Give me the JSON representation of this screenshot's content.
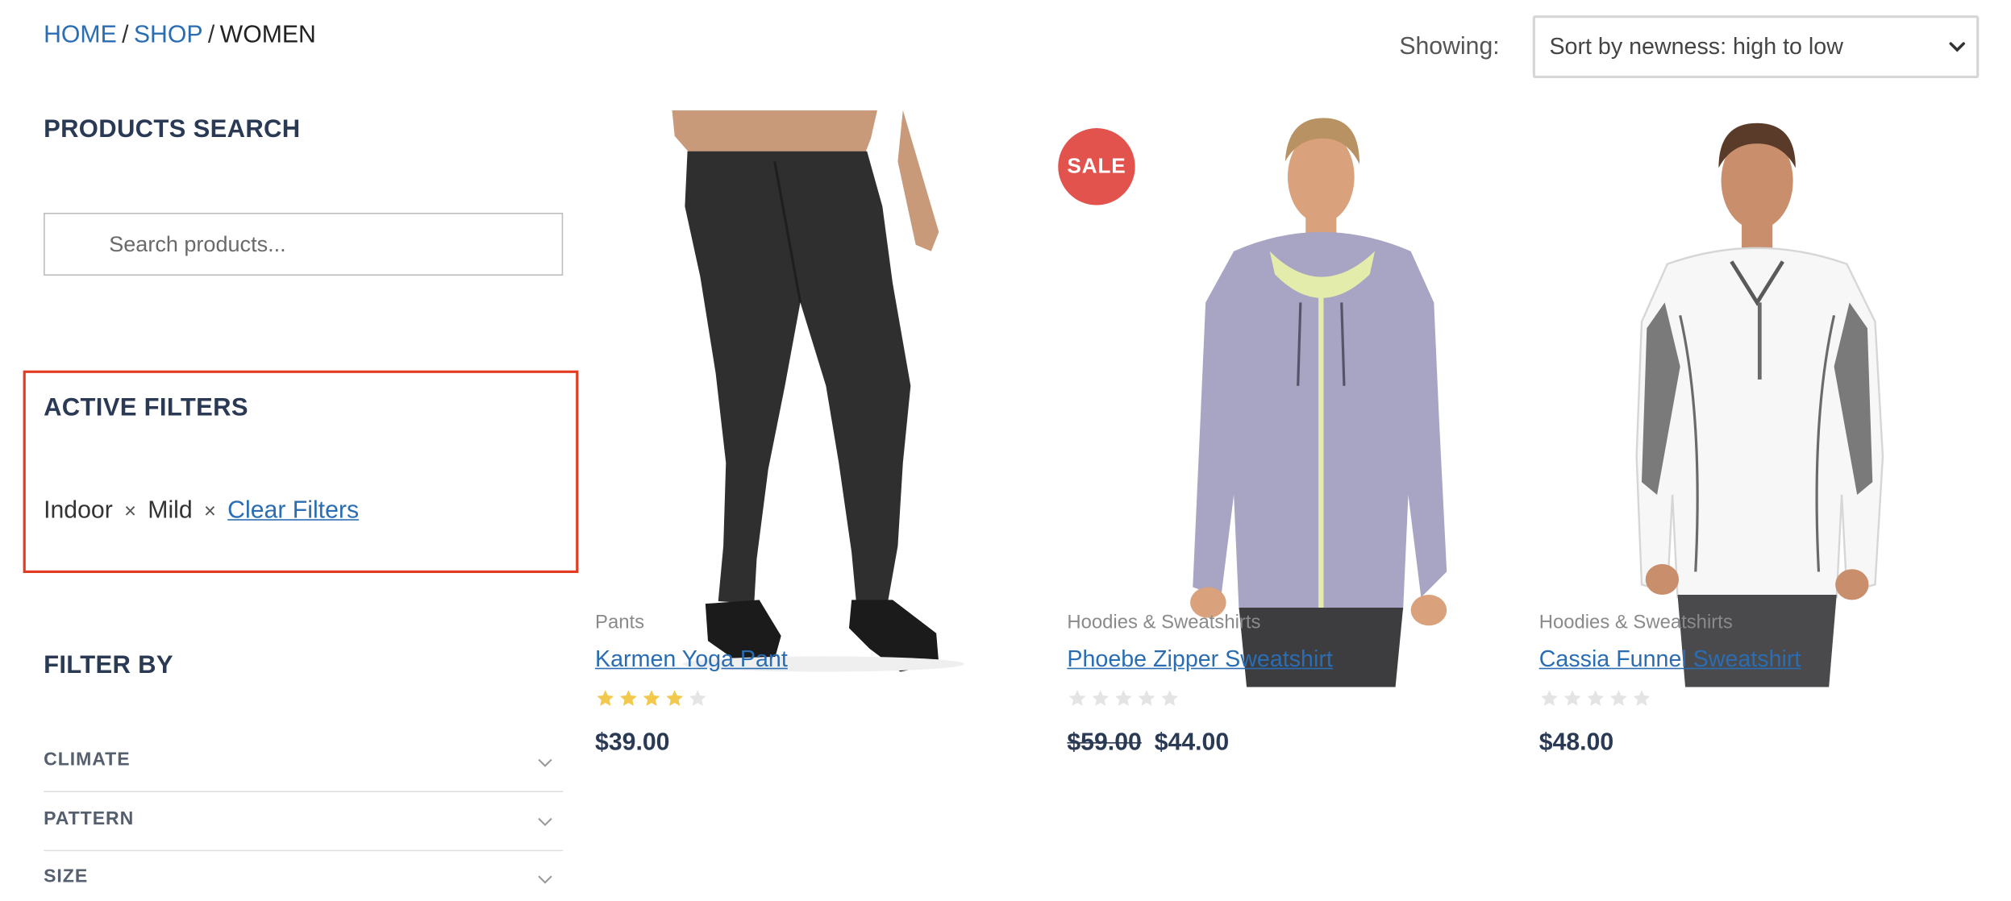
{
  "breadcrumb": {
    "home": "HOME",
    "shop": "SHOP",
    "current": "WOMEN",
    "separator": "/"
  },
  "sorting": {
    "label": "Showing:",
    "selected": "Sort by newness: high to low"
  },
  "sidebar": {
    "search_title": "PRODUCTS SEARCH",
    "search_placeholder": "Search products...",
    "active_filters_title": "ACTIVE FILTERS",
    "active_filters": [
      {
        "label": "Indoor",
        "remove": "×"
      },
      {
        "label": "Mild",
        "remove": "×"
      }
    ],
    "clear_filters": "Clear Filters",
    "filter_by_title": "FILTER BY",
    "filter_groups": [
      {
        "label": "CLIMATE"
      },
      {
        "label": "PATTERN"
      },
      {
        "label": "SIZE"
      }
    ]
  },
  "products": [
    {
      "category": "Pants",
      "name": "Karmen Yoga Pant",
      "rating": 4,
      "price": "$39.00",
      "sale": false
    },
    {
      "category": "Hoodies & Sweatshirts",
      "name": "Phoebe Zipper Sweatshirt",
      "rating": 0,
      "old_price": "$59.00",
      "price": "$44.00",
      "sale": true,
      "sale_badge": "SALE"
    },
    {
      "category": "Hoodies & Sweatshirts",
      "name": "Cassia Funnel Sweatshirt",
      "rating": 0,
      "price": "$48.00",
      "sale": false
    }
  ],
  "colors": {
    "link": "#2a6db3",
    "heading": "#2a3a55",
    "sale_badge": "#e2534e",
    "star_filled": "#f2c94c",
    "star_empty": "#e4e4e4",
    "highlight_border": "#e23b22"
  }
}
